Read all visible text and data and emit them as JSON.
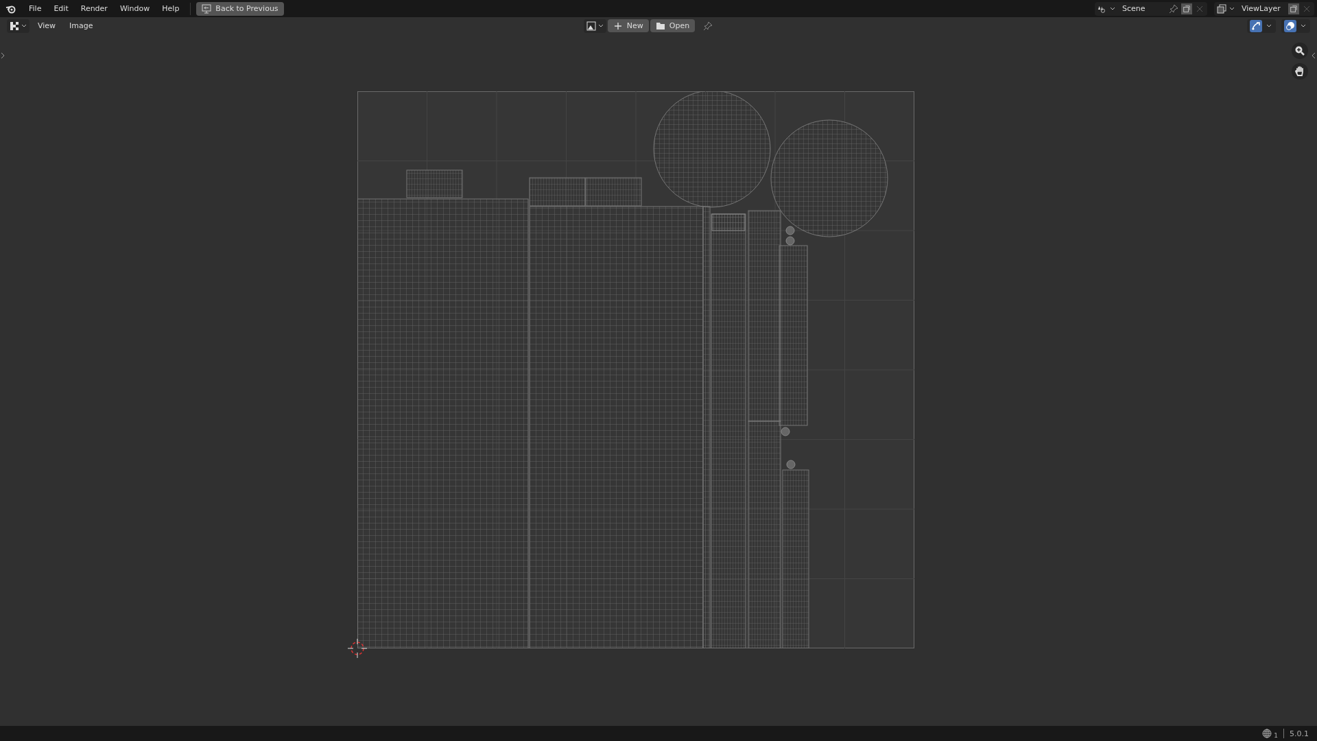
{
  "menu_bar": {
    "items": [
      "File",
      "Edit",
      "Render",
      "Window",
      "Help"
    ],
    "back_button": "Back to Previous"
  },
  "scene": {
    "name": "Scene"
  },
  "view_layer": {
    "name": "ViewLayer"
  },
  "editor_header": {
    "menus": [
      "View",
      "Image"
    ],
    "new_button": "New",
    "open_button": "Open"
  },
  "toggles": [
    {
      "kind": "gizmo",
      "on": true
    },
    {
      "kind": "overlay",
      "on": true
    }
  ],
  "status_bar": {
    "scene_count": "1",
    "version": "5.0.1"
  }
}
